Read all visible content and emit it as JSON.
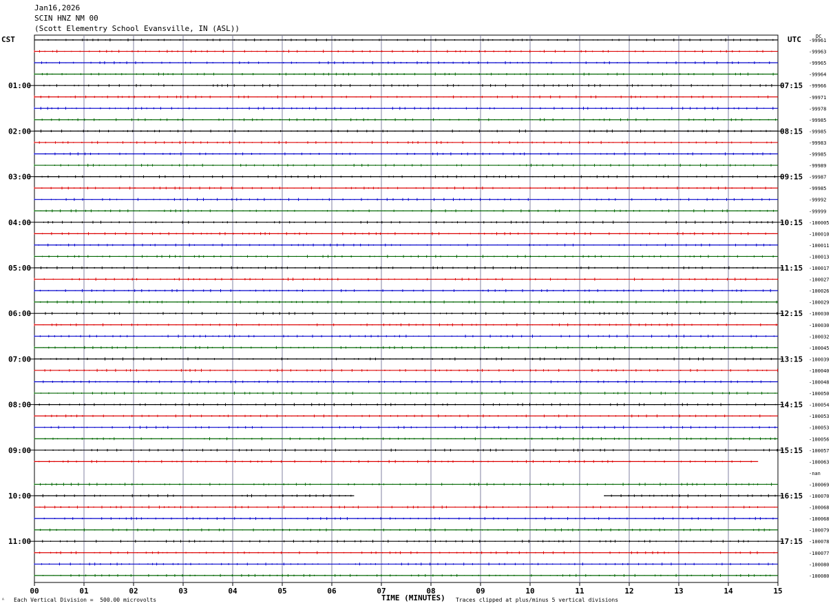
{
  "header": {
    "date": "Jan16,2026",
    "station": "SCIN HNZ NM 00",
    "location": "(Scott Elementry School Evansville, IN (ASL))"
  },
  "left_tz": "CST",
  "right_tz": "UTC",
  "dc_label": "DC",
  "footer": {
    "scale": "Each Vertical Division =  500.00 microvolts",
    "clip": "Traces clipped at plus/minus 5 vertical divisions",
    "xlabel": "TIME (MINUTES)"
  },
  "colors": {
    "black": "#000000",
    "red": "#dd0000",
    "blue": "#0000cc",
    "green": "#006600",
    "grid": "#8080a0"
  },
  "chart_data": {
    "type": "line",
    "title": "SCIN HNZ NM 00",
    "xlabel": "TIME (MINUTES)",
    "xlim": [
      0,
      15
    ],
    "x_ticks": [
      "00",
      "01",
      "02",
      "03",
      "04",
      "05",
      "06",
      "07",
      "08",
      "09",
      "10",
      "11",
      "12",
      "13",
      "14",
      "15"
    ],
    "left_time_labels": [
      "01:00",
      "02:00",
      "03:00",
      "04:00",
      "05:00",
      "06:00",
      "07:00",
      "08:00",
      "09:00",
      "10:00",
      "11:00"
    ],
    "right_time_labels": [
      "07:15",
      "08:15",
      "09:15",
      "10:15",
      "11:15",
      "12:15",
      "13:15",
      "14:15",
      "15:15",
      "16:15",
      "17:15"
    ],
    "trace_color_cycle": [
      "black",
      "red",
      "blue",
      "green"
    ],
    "dc_offsets": [
      "-99961",
      "-99963",
      "-99965",
      "-99964",
      "-99966",
      "-99971",
      "-99978",
      "-99985",
      "-99985",
      "-99983",
      "-99985",
      "-99989",
      "-99987",
      "-99985",
      "-99992",
      "-99999",
      "-100005",
      "-100010",
      "-100011",
      "-100013",
      "-100017",
      "-100027",
      "-100026",
      "-100029",
      "-100030",
      "-100030",
      "-100032",
      "-100045",
      "-100039",
      "-100040",
      "-100048",
      "-100050",
      "-100054",
      "-100053",
      "-100053",
      "-100056",
      "-100057",
      "-100063",
      "-nan",
      "-100069",
      "-100070",
      "-100068",
      "-100068",
      "-100079",
      "-100078",
      "-100077",
      "-100080",
      "-100080"
    ],
    "trace_segments": {
      "36": [
        [
          0,
          15
        ]
      ],
      "37": [
        [
          0,
          14.6
        ]
      ],
      "38": [],
      "40": [
        [
          0,
          6.45
        ],
        [
          11.5,
          15
        ]
      ]
    }
  }
}
